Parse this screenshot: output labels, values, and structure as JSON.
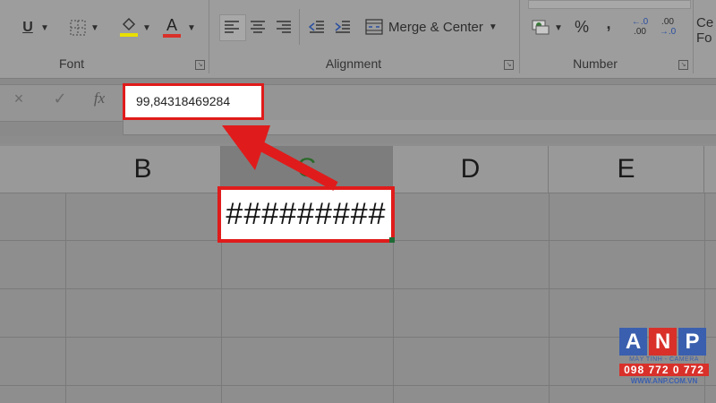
{
  "ribbon": {
    "groups": {
      "font_label": "Font",
      "alignment_label": "Alignment",
      "number_label": "Number"
    },
    "underline_label": "U",
    "font_color_label": "A",
    "merge_center_label": "Merge & Center",
    "percent_label": "%",
    "comma_label": ",",
    "increase_decimal_label": "←.0\n.00",
    "decrease_decimal_label": ".00\n→.0",
    "cell_styles_label_top": "Ce",
    "cell_styles_label_bottom": "Fo",
    "font_color_hex": "#d9302a",
    "fill_color_hex": "#e8e000"
  },
  "formula_bar": {
    "cancel_icon": "×",
    "enter_icon": "✓",
    "fx_label": "fx",
    "value": "99,84318469284"
  },
  "sheet": {
    "columns": [
      "B",
      "C",
      "D",
      "E"
    ],
    "selected_column": "C",
    "active_cell_display": "#########"
  },
  "watermark": {
    "letters": [
      "A",
      "N",
      "P"
    ],
    "tagline": "MÁY TÍNH - CAMERA",
    "phone": "098 772 0 772",
    "website": "WWW.ANP.COM.VN",
    "tile_colors": [
      "#3a5fae",
      "#d9302a",
      "#3a5fae"
    ]
  },
  "annotation": {
    "highlight_color": "#e01b1b"
  }
}
